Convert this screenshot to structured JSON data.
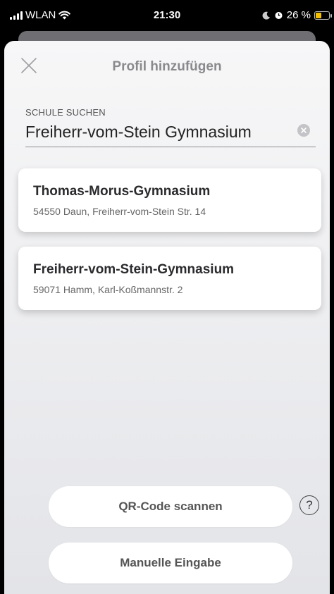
{
  "status_bar": {
    "carrier": "WLAN",
    "time": "21:30",
    "battery": "26 %"
  },
  "sheet": {
    "title": "Profil hinzufügen"
  },
  "search": {
    "label": "SCHULE SUCHEN",
    "value": "Freiherr-vom-Stein Gymnasium"
  },
  "results": [
    {
      "name": "Thomas-Morus-Gymnasium",
      "address": "54550 Daun, Freiherr-vom-Stein Str. 14"
    },
    {
      "name": "Freiherr-vom-Stein-Gymnasium",
      "address": "59071 Hamm, Karl-Koßmannstr. 2"
    }
  ],
  "actions": {
    "qr_label": "QR-Code scannen",
    "help_label": "?",
    "manual_label": "Manuelle Eingabe"
  },
  "colors": {
    "battery_charging": "#f5c000",
    "sheet_background": "#f2f2f4"
  },
  "icons": [
    "signal-icon",
    "wifi-icon",
    "moon-icon",
    "alarm-icon",
    "battery-icon",
    "close-icon",
    "clear-icon",
    "help-icon"
  ]
}
